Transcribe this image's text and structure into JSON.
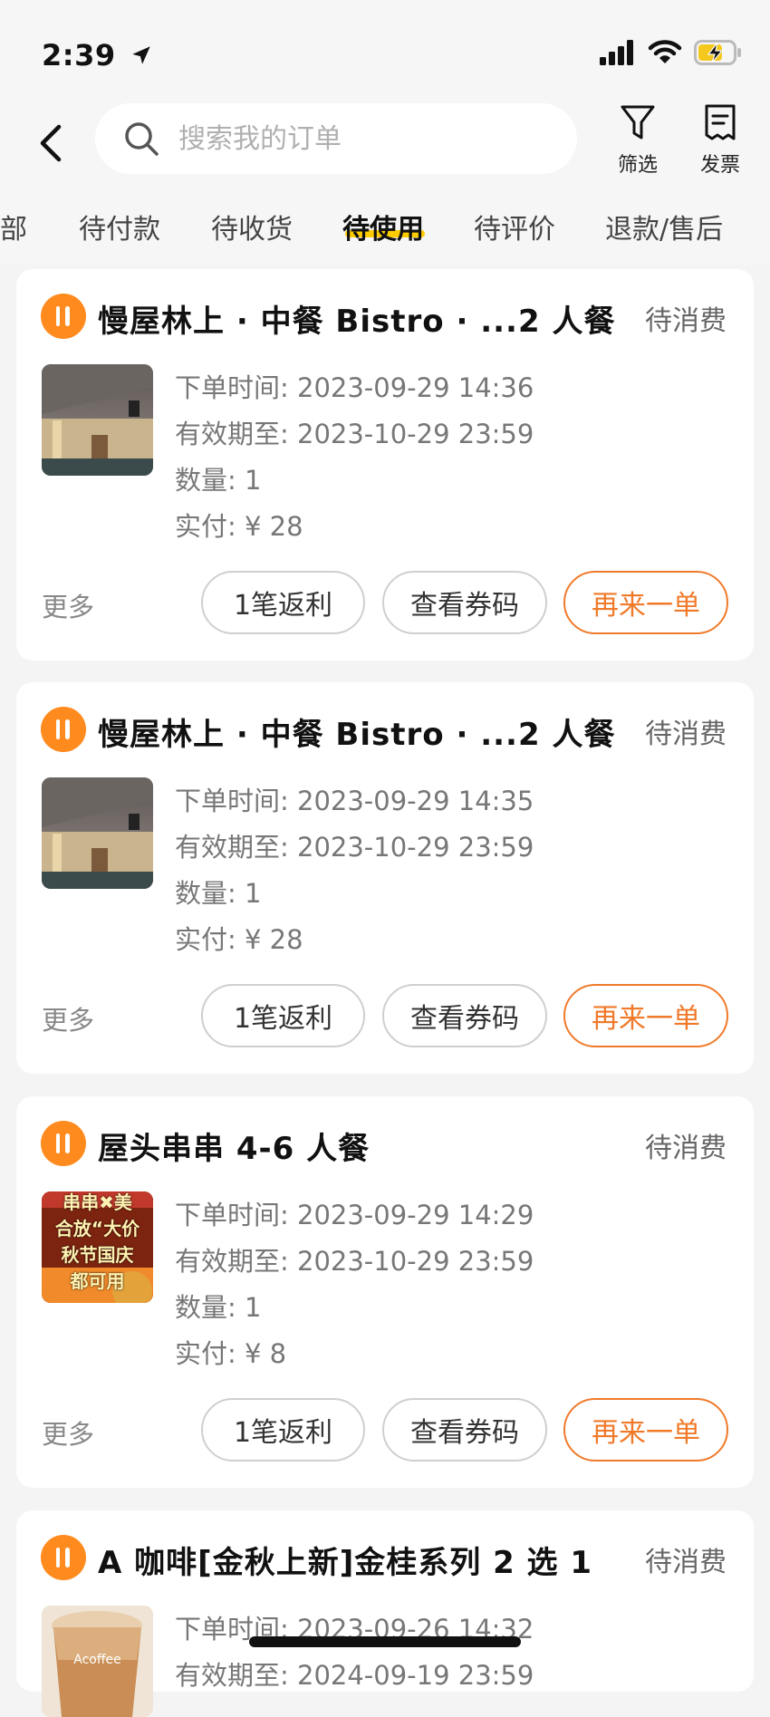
{
  "status_bar": {
    "time": "2:39"
  },
  "search": {
    "placeholder": "搜索我的订单"
  },
  "header_actions": {
    "filter_label": "筛选",
    "invoice_label": "发票"
  },
  "tabs": [
    {
      "label": "全部",
      "active": false
    },
    {
      "label": "待付款",
      "active": false
    },
    {
      "label": "待收货",
      "active": false
    },
    {
      "label": "待使用",
      "active": true
    },
    {
      "label": "待评价",
      "active": false
    },
    {
      "label": "退款/售后",
      "active": false
    }
  ],
  "colors": {
    "accent": "#f07a2a",
    "logo": "#ff8a1e",
    "tab_underline": "#ffcc00"
  },
  "orders": [
    {
      "title": "慢屋林上 · 中餐 Bistro · ...2 人餐",
      "status": "待消费",
      "order_time": "下单时间: 2023-09-29 14:36",
      "valid_until": "有效期至: 2023-10-29 23:59",
      "quantity": "数量: 1",
      "paid": "实付: ¥ 28",
      "more": "更多",
      "rebate": "1笔返利",
      "view_code": "查看券码",
      "reorder": "再来一单"
    },
    {
      "title": "慢屋林上 · 中餐 Bistro · ...2 人餐",
      "status": "待消费",
      "order_time": "下单时间: 2023-09-29 14:35",
      "valid_until": "有效期至: 2023-10-29 23:59",
      "quantity": "数量: 1",
      "paid": "实付: ¥ 28",
      "more": "更多",
      "rebate": "1笔返利",
      "view_code": "查看券码",
      "reorder": "再来一单"
    },
    {
      "title": "屋头串串 4-6 人餐",
      "status": "待消费",
      "order_time": "下单时间: 2023-09-29 14:29",
      "valid_until": "有效期至: 2023-10-29 23:59",
      "quantity": "数量: 1",
      "paid": "实付: ¥ 8",
      "more": "更多",
      "rebate": "1笔返利",
      "view_code": "查看券码",
      "reorder": "再来一单",
      "thumb_lines": [
        "串串✖美",
        "合放“大价",
        "秋节国庆",
        "都可用"
      ]
    },
    {
      "title": "A 咖啡[金秋上新]金桂系列 2 选 1",
      "status": "待消费",
      "order_time": "下单时间: 2023-09-26 14:32",
      "valid_until": "有效期至: 2024-09-19 23:59",
      "thumb_text": "Acoffee"
    }
  ]
}
